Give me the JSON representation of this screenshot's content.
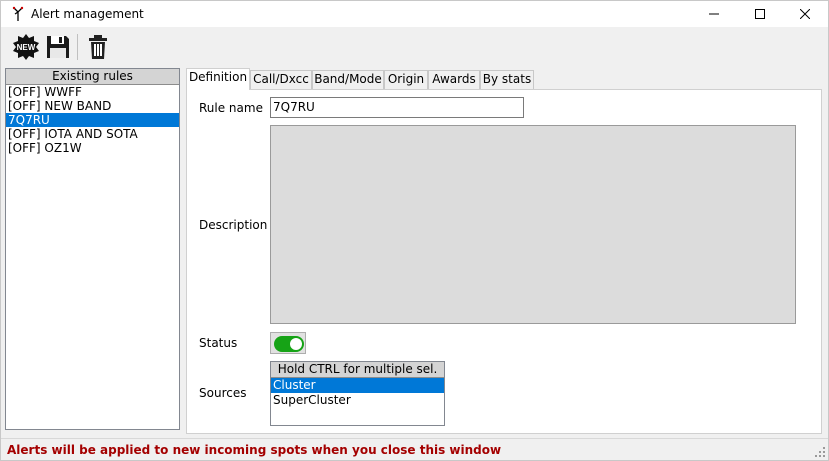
{
  "window": {
    "title": "Alert management",
    "app_icon": "antenna-icon"
  },
  "toolbar": {
    "new_label": "NEW",
    "new_icon": "new-badge-icon",
    "save_icon": "floppy-disk-icon",
    "delete_icon": "trash-can-icon"
  },
  "rules": {
    "header": "Existing rules",
    "items": [
      {
        "label": "[OFF] WWFF",
        "selected": false
      },
      {
        "label": "[OFF] NEW BAND",
        "selected": false
      },
      {
        "label": "7Q7RU",
        "selected": true
      },
      {
        "label": "[OFF] IOTA AND SOTA",
        "selected": false
      },
      {
        "label": "[OFF] OZ1W",
        "selected": false
      }
    ]
  },
  "tabs": [
    {
      "label": "Definition",
      "active": true
    },
    {
      "label": "Call/Dxcc",
      "active": false
    },
    {
      "label": "Band/Mode",
      "active": false
    },
    {
      "label": "Origin",
      "active": false
    },
    {
      "label": "Awards",
      "active": false
    },
    {
      "label": "By stats",
      "active": false
    }
  ],
  "definition": {
    "rule_name_label": "Rule name",
    "rule_name_value": "7Q7RU",
    "description_label": "Description",
    "description_value": "",
    "status_label": "Status",
    "status_on": true,
    "sources_label": "Sources",
    "sources_header": "Hold CTRL for multiple sel.",
    "sources": [
      {
        "label": "Cluster",
        "selected": true
      },
      {
        "label": "SuperCluster",
        "selected": false
      }
    ]
  },
  "status_bar": {
    "message": "Alerts will be applied to new incoming spots when you close this window"
  },
  "colors": {
    "selection": "#0078d7",
    "toggle_on": "#16a316",
    "status_message": "#a40000"
  }
}
